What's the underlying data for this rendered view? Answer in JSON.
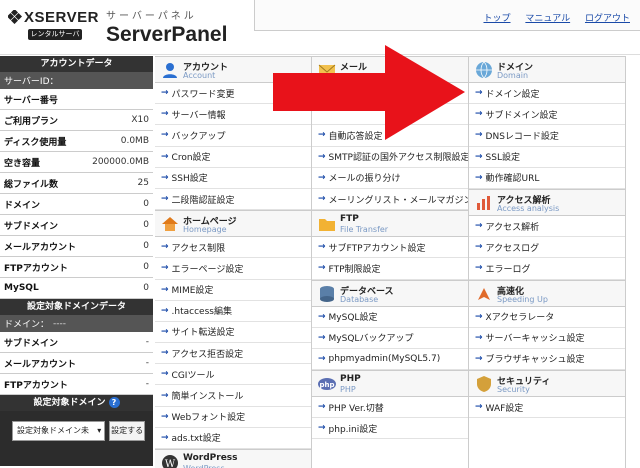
{
  "logo": {
    "brand": "XSERVER",
    "badge": "レンタルサーバー"
  },
  "header": {
    "kana": "サーバーパネル",
    "title": "ServerPanel"
  },
  "toplinks": [
    "トップ",
    "マニュアル",
    "ログアウト"
  ],
  "sidebar": {
    "account_head": "アカウントデータ",
    "server_id_label": "サーバーID：",
    "rows": [
      {
        "label": "サーバー番号",
        "value": ""
      },
      {
        "label": "ご利用プラン",
        "value": "X10"
      },
      {
        "label": "ディスク使用量",
        "value": "0.0MB"
      },
      {
        "label": "空き容量",
        "value": "200000.0MB"
      },
      {
        "label": "総ファイル数",
        "value": "25"
      },
      {
        "label": "ドメイン",
        "value": "0"
      },
      {
        "label": "サブドメイン",
        "value": "0"
      },
      {
        "label": "メールアカウント",
        "value": "0"
      },
      {
        "label": "FTPアカウント",
        "value": "0"
      },
      {
        "label": "MySQL",
        "value": "0"
      }
    ],
    "domain_head": "設定対象ドメインデータ",
    "domain_label": "ドメイン：",
    "domain_value": "----",
    "domain_rows": [
      {
        "label": "サブドメイン",
        "value": "-"
      },
      {
        "label": "メールアカウント",
        "value": "-"
      },
      {
        "label": "FTPアカウント",
        "value": "-"
      }
    ],
    "select_head": "設定対象ドメイン",
    "select_value": "設定対象ドメイン未",
    "select_button": "設定する"
  },
  "columns": {
    "c1": [
      {
        "title": "アカウント",
        "sub": "Account",
        "icon": "person-icon",
        "links": [
          "パスワード変更",
          "サーバー情報",
          "バックアップ",
          "Cron設定",
          "SSH設定",
          "二段階認証設定"
        ]
      },
      {
        "title": "ホームページ",
        "sub": "Homepage",
        "icon": "home-icon",
        "links": [
          "アクセス制限",
          "エラーページ設定",
          "MIME設定",
          ".htaccess編集",
          "サイト転送設定",
          "アクセス拒否設定",
          "CGIツール",
          "簡単インストール",
          "Webフォント設定",
          "ads.txt設定"
        ]
      },
      {
        "title": "WordPress",
        "sub": "WordPress",
        "icon": "wordpress-icon",
        "links": []
      }
    ],
    "c2": [
      {
        "title": "メール",
        "sub": "",
        "icon": "mail-icon",
        "links": [
          "",
          "",
          "自動応答設定",
          "SMTP認証の国外アクセス制限設定",
          "メールの振り分け",
          "メーリングリスト・メールマガジン"
        ]
      },
      {
        "title": "FTP",
        "sub": "File Transfer",
        "icon": "folder-icon",
        "links": [
          "サブFTPアカウント設定",
          "FTP制限設定"
        ]
      },
      {
        "title": "データベース",
        "sub": "Database",
        "icon": "database-icon",
        "links": [
          "MySQL設定",
          "MySQLバックアップ",
          "phpmyadmin(MySQL5.7)"
        ]
      },
      {
        "title": "PHP",
        "sub": "PHP",
        "icon": "php-icon",
        "links": [
          "PHP Ver.切替",
          "php.ini設定"
        ]
      }
    ],
    "c3": [
      {
        "title": "ドメイン",
        "sub": "Domain",
        "icon": "globe-icon",
        "links": [
          "ドメイン設定",
          "サブドメイン設定",
          "DNSレコード設定",
          "SSL設定",
          "動作確認URL"
        ]
      },
      {
        "title": "アクセス解析",
        "sub": "Access analysis",
        "icon": "chart-icon",
        "links": [
          "アクセス解析",
          "アクセスログ",
          "エラーログ"
        ]
      },
      {
        "title": "高速化",
        "sub": "Speeding Up",
        "icon": "rocket-icon",
        "links": [
          "Xアクセラレータ",
          "サーバーキャッシュ設定",
          "ブラウザキャッシュ設定"
        ]
      },
      {
        "title": "セキュリティ",
        "sub": "Security",
        "icon": "shield-icon",
        "links": [
          "WAF設定"
        ]
      }
    ]
  },
  "colors": {
    "accent": "#1a4aa8",
    "arrow": "#e8121a",
    "sidebar_head": "#333333"
  }
}
